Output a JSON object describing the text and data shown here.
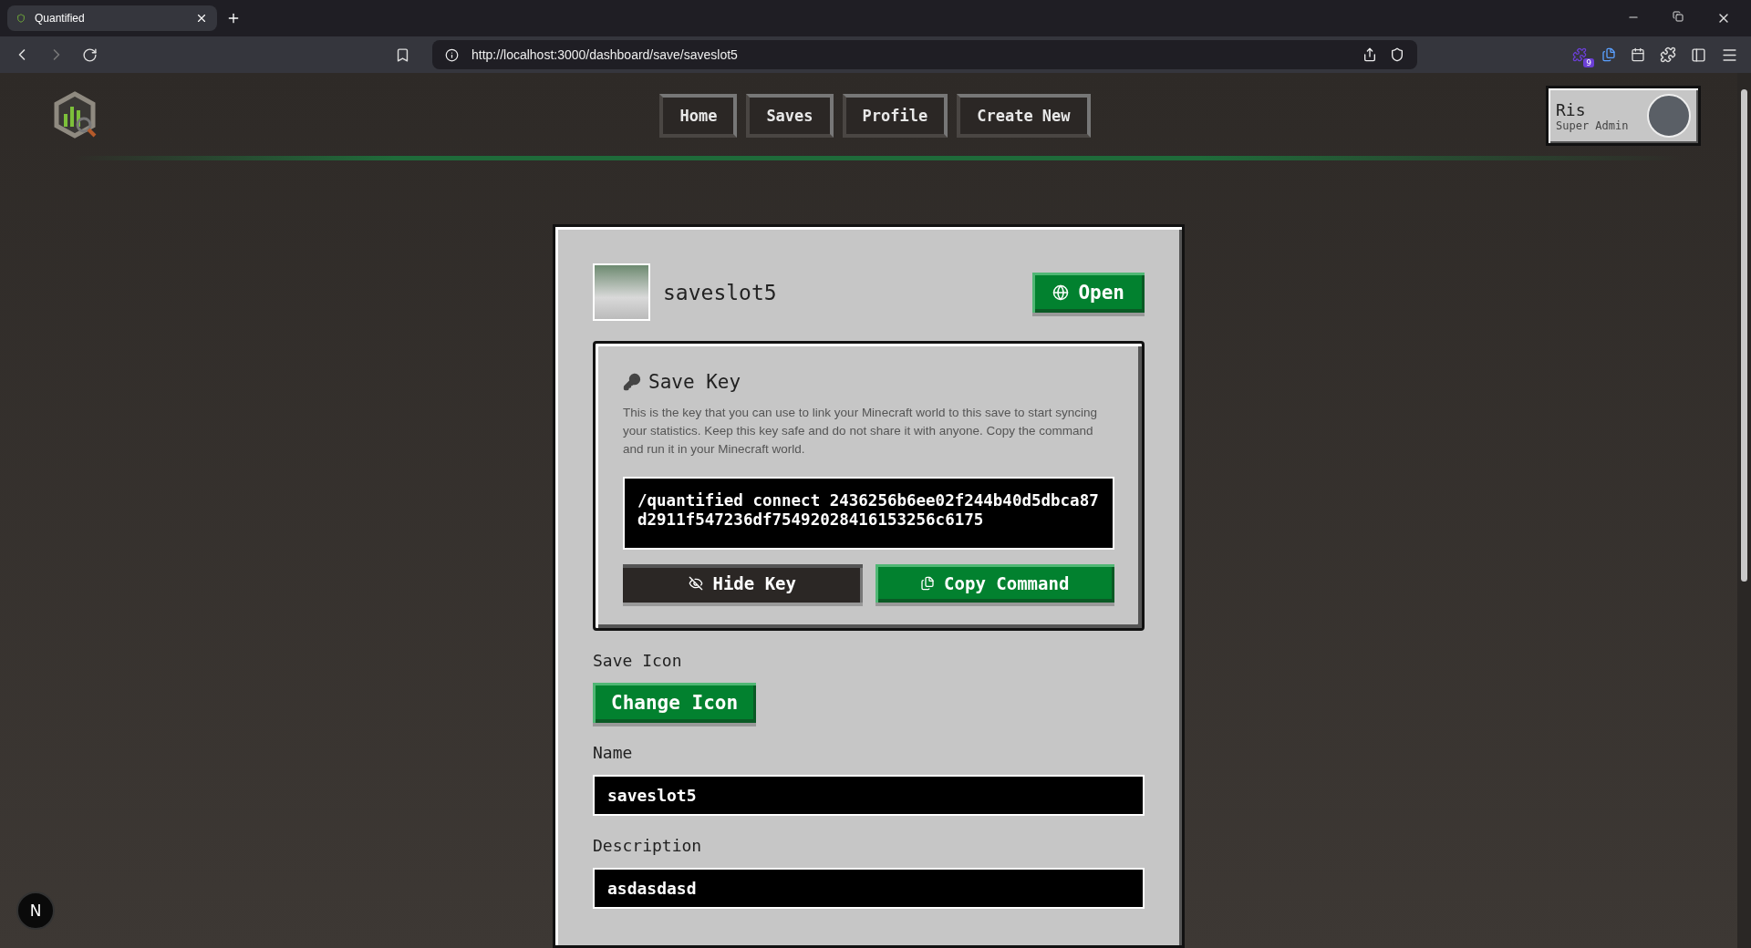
{
  "browser": {
    "tab_title": "Quantified",
    "url": "http://localhost:3000/dashboard/save/saveslot5",
    "extension_badge": "9"
  },
  "nav": [
    {
      "label": "Home"
    },
    {
      "label": "Saves"
    },
    {
      "label": "Profile"
    },
    {
      "label": "Create New"
    }
  ],
  "user": {
    "name": "Ris",
    "role": "Super Admin"
  },
  "save": {
    "name": "saveslot5",
    "open_button": "Open",
    "key_panel": {
      "title": "Save Key",
      "description": "This is the key that you can use to link your Minecraft world to this save to start syncing your statistics. Keep this key safe and do not share it with anyone. Copy the command and run it in your Minecraft world.",
      "command": "/quantified connect 2436256b6ee02f244b40d5dbca87d2911f547236df75492028416153256c6175",
      "hide_button": "Hide Key",
      "copy_button": "Copy Command"
    },
    "icon_section": {
      "label": "Save Icon",
      "button": "Change Icon"
    },
    "fields": [
      {
        "label": "Name",
        "value": "saveslot5"
      },
      {
        "label": "Description",
        "value": "asdasdasd"
      }
    ]
  },
  "dev_badge": "N"
}
